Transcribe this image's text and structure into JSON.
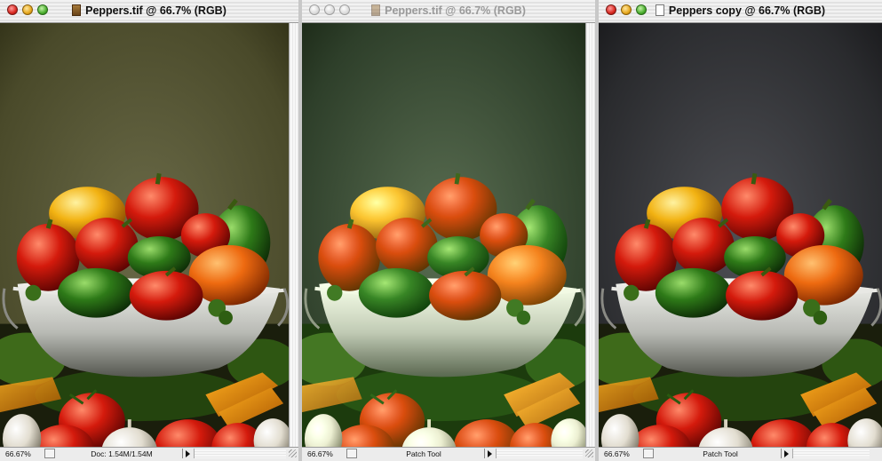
{
  "windows": [
    {
      "title": "Peppers.tif @ 66.7% (RGB)",
      "active": true,
      "doc_icon": "tif-document-icon",
      "zoom": "66.67%",
      "status_info": "Doc: 1.54M/1.54M",
      "variant": "original"
    },
    {
      "title": "Peppers.tif @ 66.7% (RGB)",
      "active": false,
      "doc_icon": "tif-document-icon",
      "zoom": "66.67%",
      "status_info": "Patch Tool",
      "variant": "green-cast"
    },
    {
      "title": "Peppers copy @ 66.7% (RGB)",
      "active": true,
      "doc_icon": "blank-document-icon",
      "zoom": "66.67%",
      "status_info": "Patch Tool",
      "variant": "corrected"
    }
  ],
  "colors": {
    "bg_original_top": "#4a4a2a",
    "bg_green_top": "#2e3f2a",
    "bg_corrected_top": "#2a2b2e",
    "pepper_red": "#c8140c",
    "pepper_yellow": "#f0b010",
    "pepper_green": "#2e7a18",
    "pepper_orange": "#e86010"
  }
}
